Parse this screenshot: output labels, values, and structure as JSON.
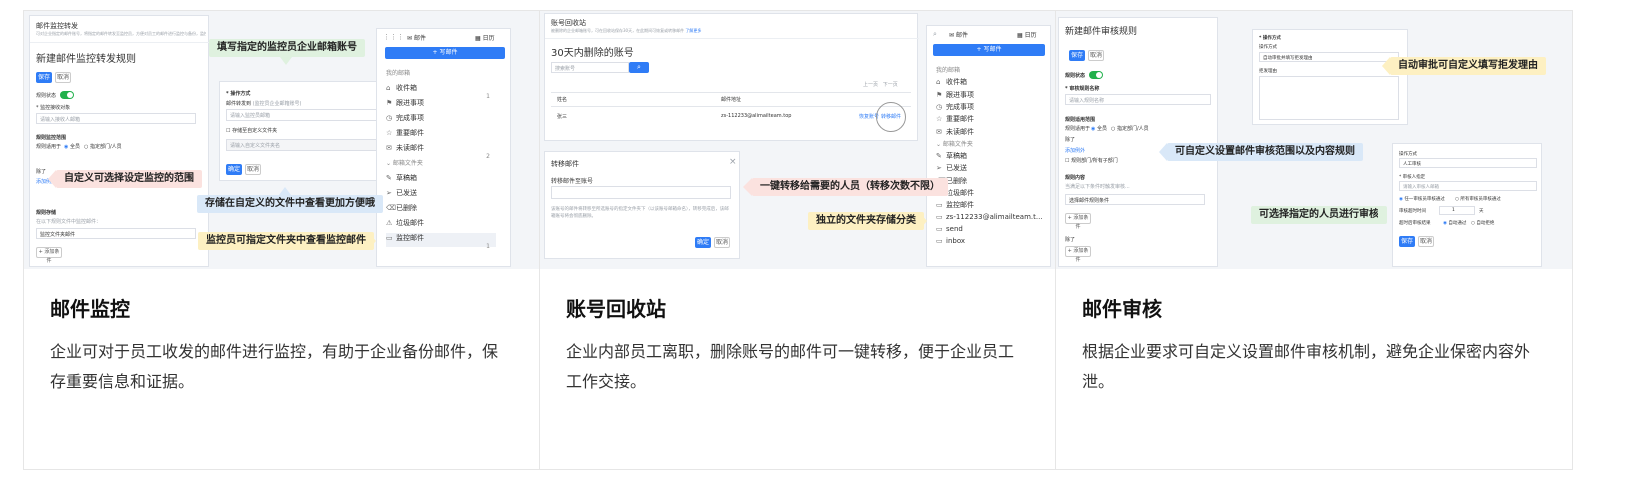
{
  "cards": [
    {
      "title": "邮件监控",
      "desc": "企业可对于员工收发的邮件进行监控，有助于企业备份邮件，保存重要信息和证据。",
      "form": {
        "header": "邮件监控转发",
        "subheader": "可对企业指定的邮件账号，将指定的邮件转发至监控员，方便对员工的邮件进行监控与备份，监控员可以…",
        "title": "新建邮件监控转发规则",
        "save": "保存",
        "cancel": "取消",
        "status_label": "规则状态",
        "recipient_label": "* 监控接收对象",
        "recipient_placeholder": "请输入接收人邮箱",
        "scope_label": "规则监控范围",
        "scope_text": "规则适用于",
        "scope_opt_all": "全员",
        "scope_opt_dept": "指定部门/人员",
        "except_label": "除了",
        "add_exception": "添加例外",
        "folder_label": "规则存储",
        "folder_desc": "在以下规则文件中监控邮件：",
        "folder_value": "监控文件夹邮件",
        "add_condition": "+ 添加条件"
      },
      "dialog": {
        "header": "* 操作方式",
        "target_label": "邮件转发到",
        "target_hint": "(监控员企业邮箱账号)",
        "target_placeholder": "请输入监控员邮箱",
        "checkbox": "存储至自定义文件夹",
        "folder_placeholder": "请输入自定义文件夹名",
        "ok": "确定",
        "cancel": "取消"
      },
      "sidebar": {
        "app": "邮件",
        "calendar": "日历",
        "compose": "+ 写邮件",
        "section_mine": "我的邮箱",
        "items": [
          {
            "icon": "⌂",
            "label": "收件箱",
            "count": "1"
          },
          {
            "icon": "⚑",
            "label": "跟进事项",
            "count": ""
          },
          {
            "icon": "◷",
            "label": "完成事项",
            "count": ""
          },
          {
            "icon": "☆",
            "label": "重要邮件",
            "count": ""
          },
          {
            "icon": "✉",
            "label": "未读邮件",
            "count": "2"
          }
        ],
        "section_folders": "邮箱文件夹",
        "folders": [
          {
            "icon": "✎",
            "label": "草稿箱"
          },
          {
            "icon": "➢",
            "label": "已发送"
          },
          {
            "icon": "⌫",
            "label": "已删除"
          },
          {
            "icon": "⚠",
            "label": "垃圾邮件"
          },
          {
            "icon": "▭",
            "label": "监控邮件",
            "count": "1"
          }
        ]
      },
      "callouts": {
        "fill_account": "填写指定的监控员企业邮箱账号",
        "custom_scope": "自定义可选择设定监控的范围",
        "custom_folder": "存储在自定义的文件中查看更加方便哦",
        "monitor_folder": "监控员可指定文件夹中查看监控邮件"
      }
    },
    {
      "title": "账号回收站",
      "desc": "企业内部员工离职，删除账号的邮件可一键转移，便于企业员工工作交接。",
      "page": {
        "header": "账号回收站",
        "subheader": "被删除的企业邮箱账号，可在回收站保存30天，在此期间可恢复或转移邮件",
        "link": "了解更多",
        "title": "30天内删除的账号",
        "search_placeholder": "搜索账号",
        "col_name": "姓名",
        "col_email": "邮件地址",
        "row_name": "张三",
        "row_email": "zs-112233@alimailteam.top",
        "restore": "恢复账号",
        "transfer": "转移邮件",
        "pager_prev": "上一页",
        "pager_next": "下一页"
      },
      "modal": {
        "title": "转移邮件",
        "close": "×",
        "label": "转移邮件至账号",
        "note": "该账号的邮件将转移至所选账号的指定文件夹下（以该账号邮箱命名），转移完成后，该邮箱账号将会彻底删除。",
        "ok": "确定",
        "cancel": "取消"
      },
      "sidebar": {
        "app": "邮件",
        "calendar": "日历",
        "compose": "+ 写邮件",
        "section_mine": "我的邮箱",
        "items": [
          {
            "icon": "⌂",
            "label": "收件箱",
            "count": ""
          },
          {
            "icon": "⚑",
            "label": "跟进事项",
            "count": ""
          },
          {
            "icon": "◷",
            "label": "完成事项",
            "count": ""
          },
          {
            "icon": "☆",
            "label": "重要邮件",
            "count": ""
          },
          {
            "icon": "✉",
            "label": "未读邮件",
            "count": ""
          }
        ],
        "section_folders": "邮箱文件夹",
        "folders": [
          {
            "icon": "✎",
            "label": "草稿箱"
          },
          {
            "icon": "➢",
            "label": "已发送"
          },
          {
            "icon": "⌫",
            "label": "已删除"
          },
          {
            "icon": "⚠",
            "label": "垃圾邮件"
          },
          {
            "icon": "▭",
            "label": "监控邮件"
          },
          {
            "icon": "▭",
            "label": "zs-112233@alimailteam.t..."
          },
          {
            "icon": "▭",
            "label": "send"
          },
          {
            "icon": "▭",
            "label": "inbox"
          }
        ]
      },
      "callouts": {
        "one_click": "一键转移给需要的人员（转移次数不限）",
        "folder_sort": "独立的文件夹存储分类"
      }
    },
    {
      "title": "邮件审核",
      "desc": "根据企业要求可自定义设置邮件审核机制，避免企业保密内容外泄。",
      "form": {
        "title": "新建邮件审核规则",
        "save": "保存",
        "cancel": "取消",
        "status_label": "规则状态",
        "approver_label": "* 审核规则名称",
        "approver_placeholder": "请输入规则名称",
        "scope_label": "规则适用范围",
        "scope_text": "规则适用于",
        "scope_opt_all": "全员",
        "scope_opt_dept": "指定部门/人员",
        "except_label": "除了",
        "add_exception": "添加例外",
        "dept_check": "规则部门/所有子部门",
        "cond_label": "规则内容",
        "cond_desc": "当满足以下条件时触发审核...",
        "cond_value": "选择邮件规则条件",
        "add_condition": "+ 添加条件",
        "except2": "除了",
        "add_condition2": "+ 添加条件"
      },
      "reason": {
        "header": "* 操作方式",
        "line1": "操作方式",
        "value": "自动审批并填写拒发理由",
        "label2": "拒发理由"
      },
      "approve": {
        "label": "操作方式",
        "value": "人工审核",
        "approver_label": "* 审核人指定",
        "approver_placeholder": "请输入审核人邮箱",
        "opt1": "任一审核员审核通过",
        "opt2": "所有审核员审核通过",
        "timeout_label": "审核超时时间",
        "timeout_value": "1",
        "timeout_unit": "天",
        "after_label": "超时后审核结果",
        "after_opt1": "自动通过",
        "after_opt2": "自动拒绝",
        "ok": "保存",
        "cancel": "取消"
      },
      "callouts": {
        "auto_reason": "自动审批可自定义填写拒发理由",
        "custom_rules": "可自定义设置邮件审核范围以及内容规则",
        "pick_person": "可选择指定的人员进行审核"
      }
    }
  ]
}
